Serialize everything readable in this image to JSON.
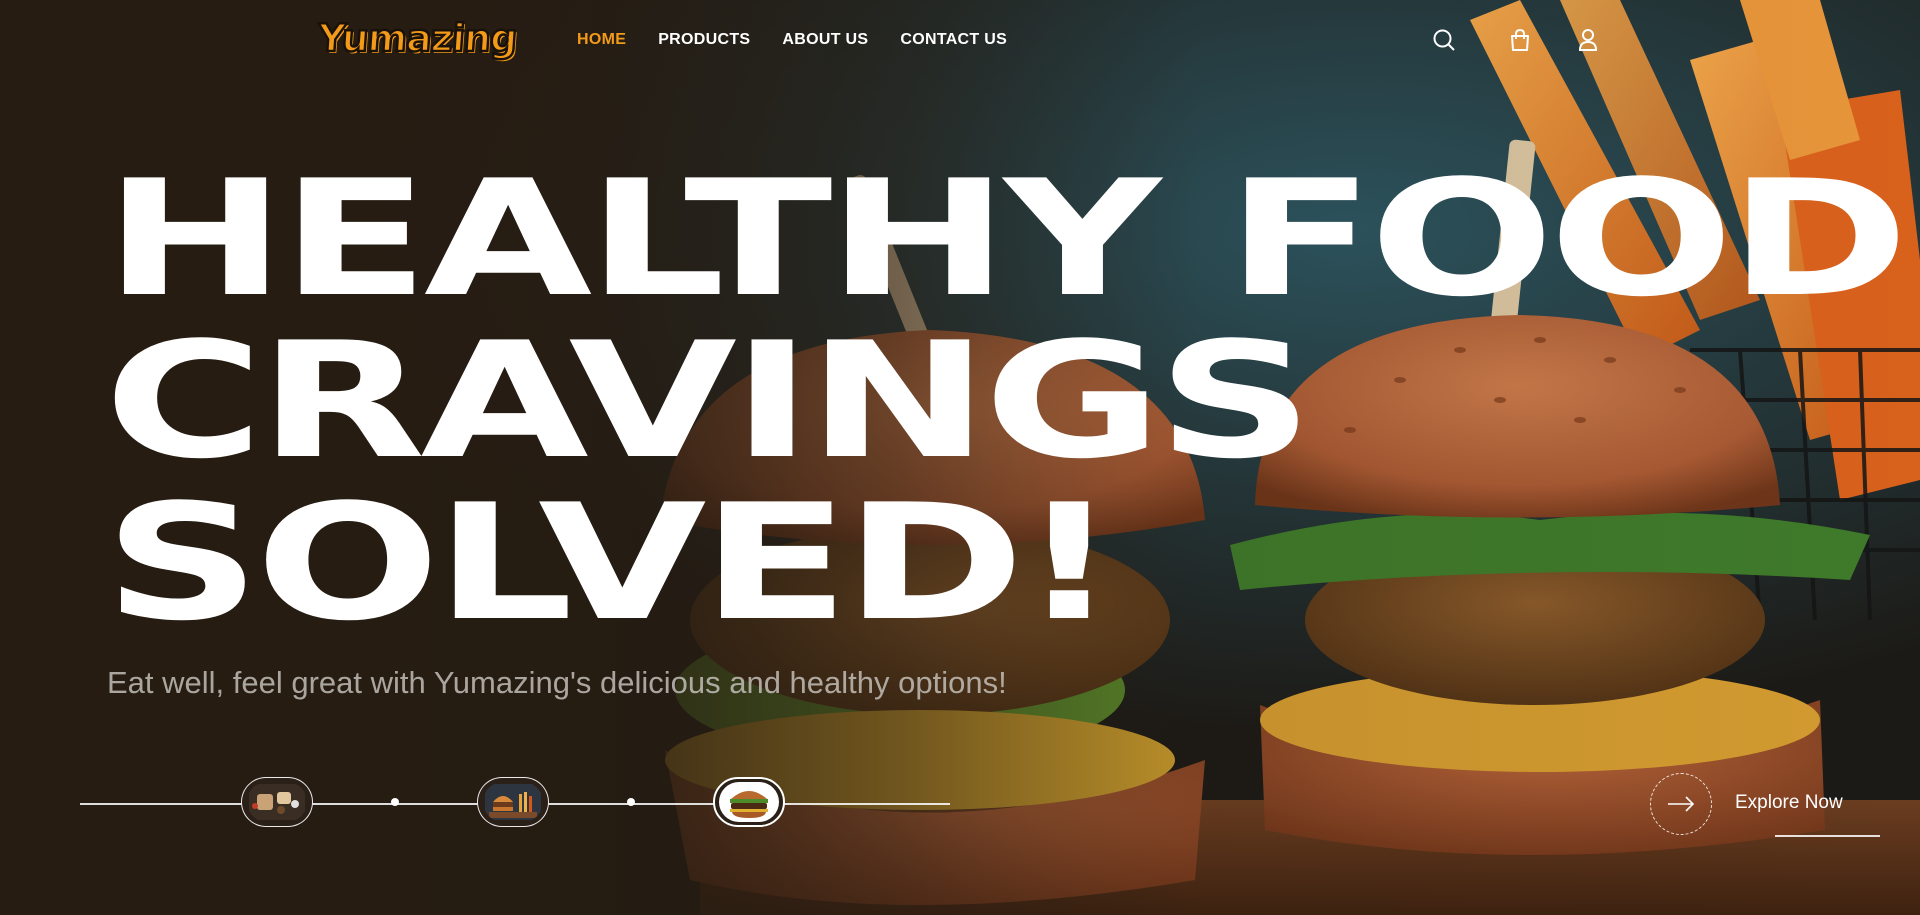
{
  "brand": {
    "logo_text": "Yumazing",
    "accent_color": "#f39a18"
  },
  "nav": {
    "items": [
      {
        "label": "HOME",
        "active": true
      },
      {
        "label": "PRODUCTS",
        "active": false
      },
      {
        "label": "ABOUT US",
        "active": false
      },
      {
        "label": "CONTACT US",
        "active": false
      }
    ]
  },
  "header_icons": [
    "search-icon",
    "shopping-bag-icon",
    "user-icon"
  ],
  "hero": {
    "headline_lines": [
      "HEALTHY FOOD",
      "CRAVINGS",
      "SOLVED!"
    ],
    "subtitle": "Eat well, feel great with Yumazing's delicious and healthy options!"
  },
  "slider": {
    "thumbnails": [
      {
        "name": "food-platter-thumbnail",
        "active": false
      },
      {
        "name": "burger-and-fries-thumbnail",
        "active": false
      },
      {
        "name": "burger-thumbnail",
        "active": true
      }
    ]
  },
  "cta": {
    "label": "Explore Now",
    "icon": "arrow-right-icon"
  }
}
